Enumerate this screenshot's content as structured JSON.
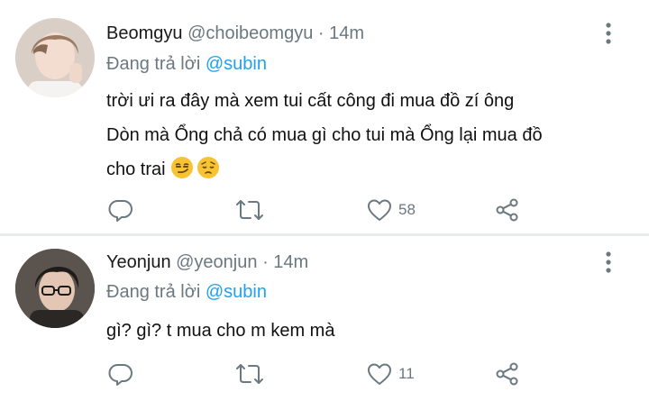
{
  "tweets": [
    {
      "name": "Beomgyu",
      "handle": "@choibeomgyu",
      "dot": "·",
      "time": "14m",
      "reply_prefix": "Đang trả lời",
      "reply_to": "@subin",
      "lines": [
        "trời ưi ra đây mà xem tui cất công đi mua đồ zí ông",
        "Dòn mà Ổng chả có mua gì cho tui mà Ổng lại mua đồ",
        "cho trai"
      ],
      "emojis": [
        "smirking-face",
        "pensive-face"
      ],
      "likes": "58",
      "icons": [
        "reply-icon",
        "retweet-icon",
        "heart-icon",
        "share-icon"
      ]
    },
    {
      "name": "Yeonjun",
      "handle": "@yeonjun",
      "dot": "·",
      "time": "14m",
      "reply_prefix": "Đang trả lời",
      "reply_to": "@subin",
      "lines": [
        "gì? gì? t mua cho m kem mà"
      ],
      "likes": "11",
      "icons": [
        "reply-icon",
        "retweet-icon",
        "heart-icon",
        "share-icon"
      ]
    }
  ],
  "colors": {
    "text": "#111111",
    "secondary": "#6b7880",
    "mention": "#1da1f2",
    "divider": "#e8ecef",
    "emoji": "#f7c332"
  }
}
